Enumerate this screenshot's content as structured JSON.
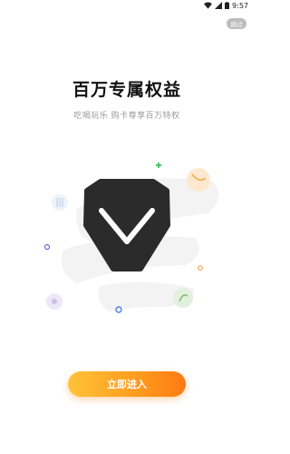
{
  "status_bar": {
    "time": "9:57",
    "icons": [
      "wifi-icon",
      "signal-icon",
      "battery-icon"
    ]
  },
  "skip_button": {
    "label": "跳过"
  },
  "headline": {
    "title": "百万专属权益",
    "subtitle": "吃喝玩乐 购卡尊享百万特权"
  },
  "hero": {
    "icon": "diamond-chevron-icon"
  },
  "cta": {
    "label": "立即进入"
  },
  "colors": {
    "accent_start": "#ffc23a",
    "accent_end": "#ff7a14",
    "diamond": "#2b2b2b",
    "skip_bg": "#bdbdbd"
  }
}
